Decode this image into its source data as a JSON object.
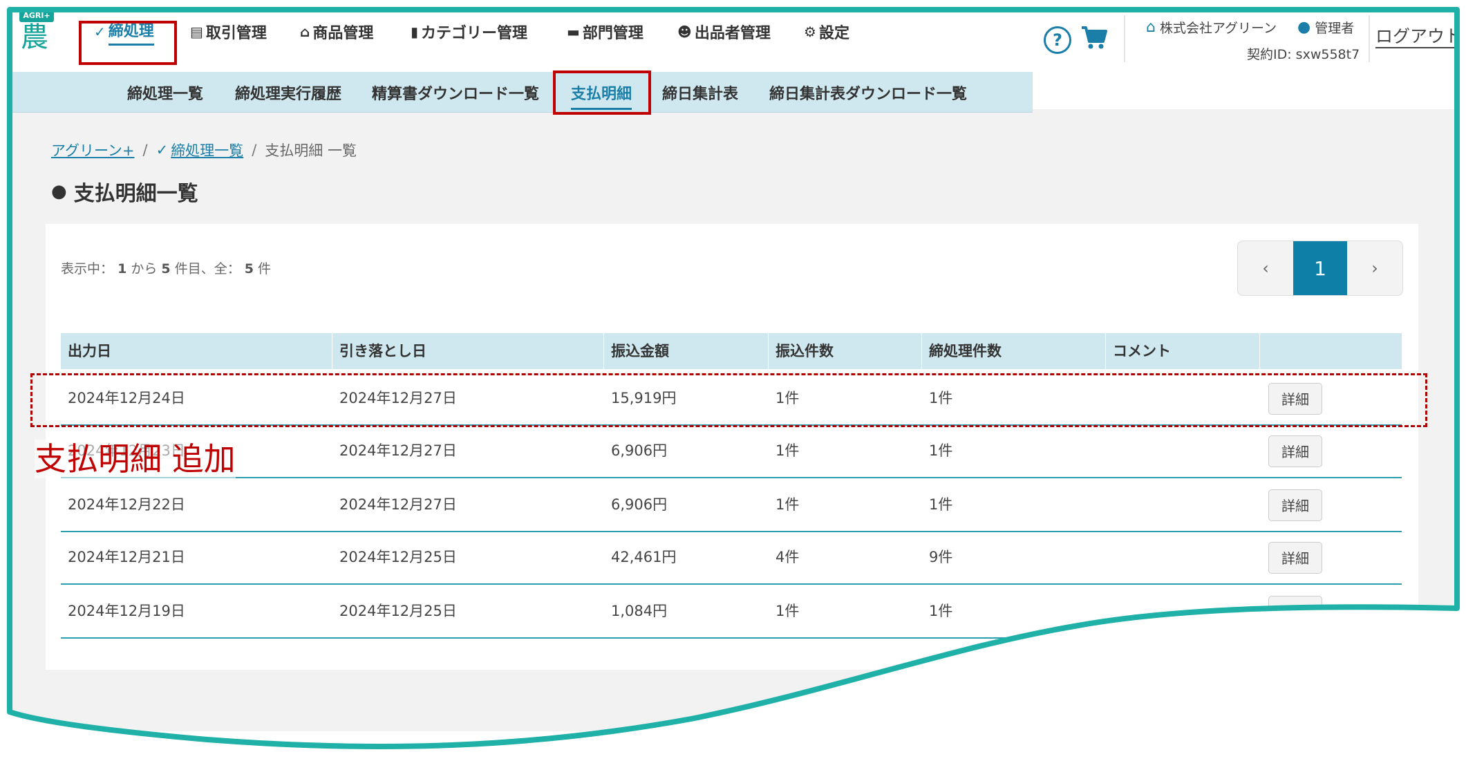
{
  "logo": {
    "tag": "AGRI+",
    "glyph": "農"
  },
  "nav": {
    "items": [
      {
        "label": "締処理",
        "icon": "✓"
      },
      {
        "label": "取引管理",
        "icon": "▤"
      },
      {
        "label": "商品管理",
        "icon": "⌂"
      },
      {
        "label": "カテゴリー管理",
        "icon": "▮"
      },
      {
        "label": "部門管理",
        "icon": "▬"
      },
      {
        "label": "出品者管理",
        "icon": "☻"
      },
      {
        "label": "設定",
        "icon": "⚙"
      }
    ]
  },
  "header": {
    "help_icon": "?",
    "company": "株式会社アグリーン",
    "role": "管理者",
    "contract": "契約ID: sxw558t7",
    "logout": "ログアウト"
  },
  "subnav": {
    "items": [
      "締処理一覧",
      "締処理実行履歴",
      "精算書ダウンロード一覧",
      "支払明細",
      "締日集計表",
      "締日集計表ダウンロード一覧"
    ]
  },
  "breadcrumb": {
    "root": "アグリーン+",
    "parent": "締処理一覧",
    "current": "支払明細 一覧",
    "sep": "/"
  },
  "page_title": "支払明細一覧",
  "count": {
    "prefix": "表示中：",
    "from": "1",
    "mid1": "から",
    "to": "5",
    "mid2": "件目、全：",
    "total": "5",
    "suffix": "件"
  },
  "pager": {
    "prev": "‹",
    "current": "1",
    "next": "›"
  },
  "table": {
    "headers": [
      "出力日",
      "引き落とし日",
      "振込金額",
      "振込件数",
      "締処理件数",
      "コメント",
      ""
    ],
    "rows": [
      {
        "output_date": "2024年12月24日",
        "debit_date": "2024年12月27日",
        "amount": "15,919円",
        "transfers": "1件",
        "closings": "1件",
        "comment": "",
        "action": "詳細"
      },
      {
        "output_date": "2024年12月23日",
        "debit_date": "2024年12月27日",
        "amount": "6,906円",
        "transfers": "1件",
        "closings": "1件",
        "comment": "",
        "action": "詳細"
      },
      {
        "output_date": "2024年12月22日",
        "debit_date": "2024年12月27日",
        "amount": "6,906円",
        "transfers": "1件",
        "closings": "1件",
        "comment": "",
        "action": "詳細"
      },
      {
        "output_date": "2024年12月21日",
        "debit_date": "2024年12月25日",
        "amount": "42,461円",
        "transfers": "4件",
        "closings": "9件",
        "comment": "",
        "action": "詳細"
      },
      {
        "output_date": "2024年12月19日",
        "debit_date": "2024年12月25日",
        "amount": "1,084円",
        "transfers": "1件",
        "closings": "1件",
        "comment": "",
        "action": "詳細"
      }
    ]
  },
  "annotation": "支払明細 追加",
  "colors": {
    "accent": "#1a7ea8",
    "teal_frame": "#1fb1a8",
    "annotation_red": "#c00000",
    "subnav_bg": "#cfe7ee"
  }
}
